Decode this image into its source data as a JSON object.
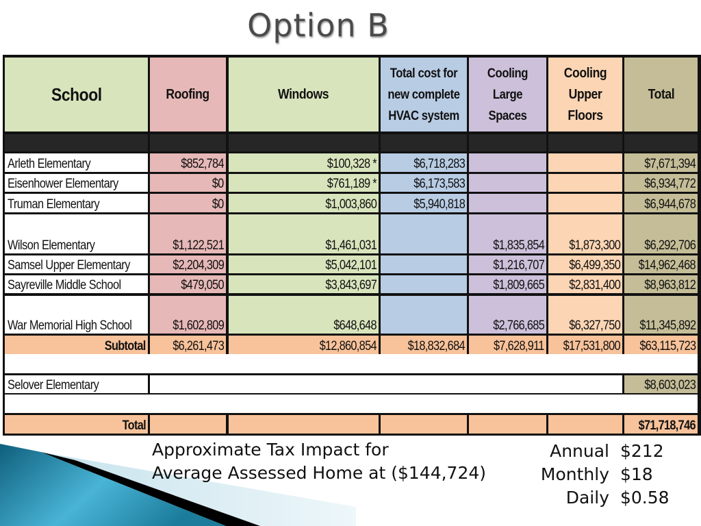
{
  "slide": {
    "title": "Option B"
  },
  "table": {
    "headers": {
      "school": "School",
      "roofing": "Roofing",
      "windows": "Windows",
      "hvac": "Total cost for new complete HVAC system",
      "cooling_large": "Cooling Large Spaces",
      "cooling_upper": "Cooling Upper Floors",
      "total": "Total"
    },
    "rows": [
      {
        "school": "Arleth Elementary",
        "roofing": "$852,784",
        "windows": "$100,328 *",
        "hvac": "$6,718,283",
        "cooling_large": "",
        "cooling_upper": "",
        "total": "$7,671,394"
      },
      {
        "school": "Eisenhower Elementary",
        "roofing": "$0",
        "windows": "$761,189 *",
        "hvac": "$6,173,583",
        "cooling_large": "",
        "cooling_upper": "",
        "total": "$6,934,772"
      },
      {
        "school": "Truman Elementary",
        "roofing": "$0",
        "windows": "$1,003,860",
        "hvac": "$5,940,818",
        "cooling_large": "",
        "cooling_upper": "",
        "total": "$6,944,678"
      },
      {
        "school": "Wilson Elementary",
        "roofing": "$1,122,521",
        "windows": "$1,461,031",
        "hvac": "",
        "cooling_large": "$1,835,854",
        "cooling_upper": "$1,873,300",
        "total": "$6,292,706"
      },
      {
        "school": "Samsel Upper Elementary",
        "roofing": "$2,204,309",
        "windows": "$5,042,101",
        "hvac": "",
        "cooling_large": "$1,216,707",
        "cooling_upper": "$6,499,350",
        "total": "$14,962,468"
      },
      {
        "school": "Sayreville Middle School",
        "roofing": "$479,050",
        "windows": "$3,843,697",
        "hvac": "",
        "cooling_large": "$1,809,665",
        "cooling_upper": "$2,831,400",
        "total": "$8,963,812"
      },
      {
        "school": "War Memorial High School",
        "roofing": "$1,602,809",
        "windows": "$648,648",
        "hvac": "",
        "cooling_large": "$2,766,685",
        "cooling_upper": "$6,327,750",
        "total": "$11,345,892"
      }
    ],
    "subtotal": {
      "label": "Subtotal",
      "roofing": "$6,261,473",
      "windows": "$12,860,854",
      "hvac": "$18,832,684",
      "cooling_large": "$7,628,911",
      "cooling_upper": "$17,531,800",
      "total": "$63,115,723"
    },
    "selover": {
      "school": "Selover Elementary",
      "total": "$8,603,023"
    },
    "grand_total": {
      "label": "Total",
      "total": "$71,718,746"
    }
  },
  "tax_impact": {
    "line1": "Approximate Tax Impact for",
    "line2": "Average Assessed Home at ($144,724)",
    "items": [
      {
        "label": "Annual",
        "value": "$212"
      },
      {
        "label": "Monthly",
        "value": "$18"
      },
      {
        "label": "Daily",
        "value": "$0.58"
      }
    ]
  },
  "colors": {
    "roofing": "#e6b8b7",
    "windows": "#d8e4bc",
    "hvac": "#b8cce4",
    "cooling_large": "#ccc0da",
    "cooling_upper": "#fcd5b4",
    "total": "#c4bd97",
    "subtotal_row": "#f8c29a",
    "accent_teal": "#2a8fb0"
  }
}
